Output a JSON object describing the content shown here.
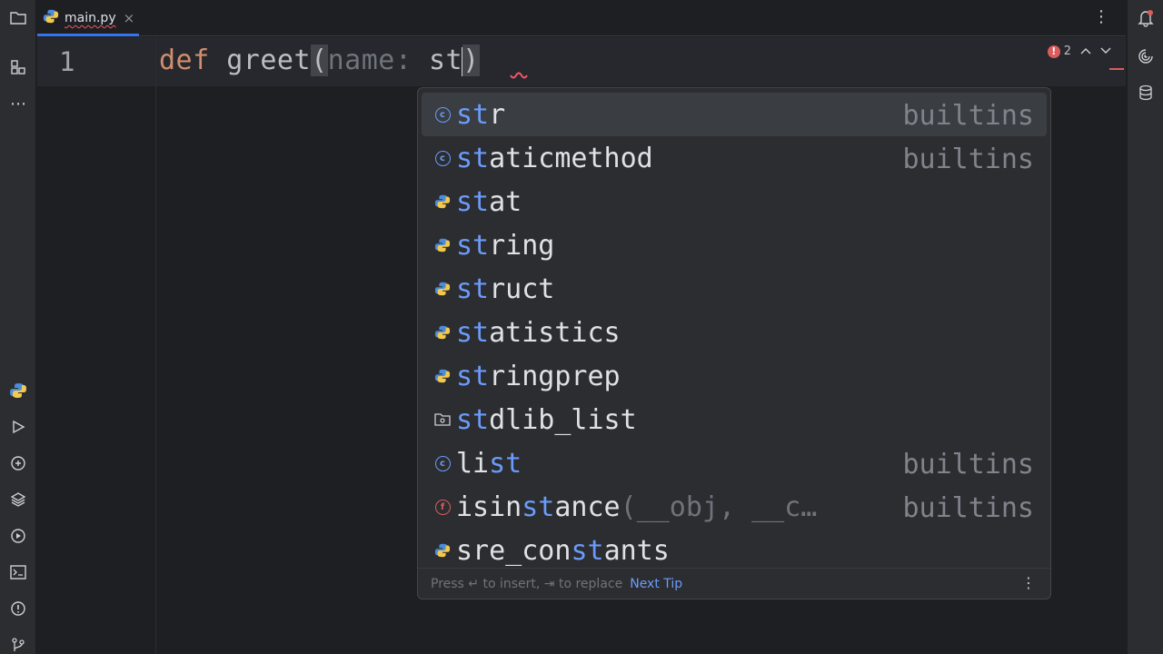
{
  "tab": {
    "title": "main.py",
    "close": "×"
  },
  "editor": {
    "line_number": "1",
    "code": {
      "keyword": "def",
      "name": "greet",
      "open_paren": "(",
      "param": "name: ",
      "typed": "st",
      "close_paren": ")"
    }
  },
  "inspections": {
    "error_count": "2"
  },
  "completion": {
    "items": [
      {
        "icon": "class-icon",
        "match": "st",
        "rest": "r",
        "type_hint": "",
        "source": "builtins",
        "selected": true
      },
      {
        "icon": "class-icon",
        "match": "st",
        "rest": "aticmethod",
        "type_hint": "",
        "source": "builtins"
      },
      {
        "icon": "python-module-icon",
        "match": "st",
        "rest": "at",
        "type_hint": "",
        "source": ""
      },
      {
        "icon": "python-module-icon",
        "match": "st",
        "rest": "ring",
        "type_hint": "",
        "source": ""
      },
      {
        "icon": "python-module-icon",
        "match": "st",
        "rest": "ruct",
        "type_hint": "",
        "source": ""
      },
      {
        "icon": "python-module-icon",
        "match": "st",
        "rest": "atistics",
        "type_hint": "",
        "source": ""
      },
      {
        "icon": "python-module-icon",
        "match": "st",
        "rest": "ringprep",
        "type_hint": "",
        "source": ""
      },
      {
        "icon": "package-icon",
        "match": "st",
        "rest": "dlib_list",
        "type_hint": "",
        "source": ""
      },
      {
        "icon": "class-icon",
        "pre": "li",
        "match": "st",
        "rest": "",
        "type_hint": "",
        "source": "builtins"
      },
      {
        "icon": "function-icon",
        "pre": "isin",
        "match": "st",
        "rest": "ance",
        "type_hint": "(__obj, __c…",
        "source": "builtins"
      },
      {
        "icon": "python-module-icon",
        "pre": "sre_con",
        "match": "st",
        "rest": "ants",
        "type_hint": "",
        "source": ""
      }
    ],
    "footer": {
      "hint_insert": "Press ↵ to insert, ⇥ to replace",
      "next_tip": "Next Tip"
    }
  }
}
